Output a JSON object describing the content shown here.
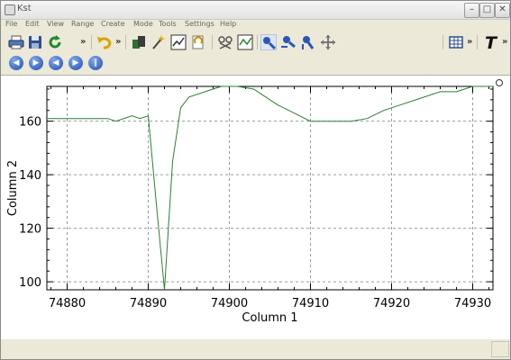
{
  "window": {
    "title": "Kst"
  },
  "menus": [
    "File",
    "Edit",
    "View",
    "Range",
    "Create",
    "Mode",
    "Tools",
    "Settings",
    "Help"
  ],
  "chart_data": {
    "type": "line",
    "xlabel": "Column 1",
    "ylabel": "Column 2",
    "xlim": [
      74877.5,
      74932.5
    ],
    "ylim": [
      97,
      173
    ],
    "x_ticks": [
      74880,
      74890,
      74900,
      74910,
      74920,
      74930
    ],
    "y_ticks": [
      100,
      120,
      140,
      160
    ],
    "grid": true,
    "line_color": "#2f7f2f",
    "series": [
      {
        "x": [
          74877.5,
          74880,
          74885,
          74886,
          74888,
          74889,
          74890,
          74891,
          74892,
          74893,
          74894,
          74895,
          74897,
          74899,
          74901,
          74903,
          74904,
          74906,
          74908,
          74910,
          74911,
          74915,
          74917,
          74919,
          74921,
          74923,
          74925,
          74926,
          74928,
          74929,
          74930,
          74932.5
        ],
        "values": [
          161,
          161,
          161,
          160,
          162,
          161,
          162,
          129,
          97,
          145,
          165,
          169,
          171,
          173,
          173,
          172,
          170,
          166,
          163,
          160,
          160,
          160,
          161,
          164,
          166,
          168,
          170,
          171,
          171,
          172,
          173,
          173
        ]
      }
    ]
  }
}
